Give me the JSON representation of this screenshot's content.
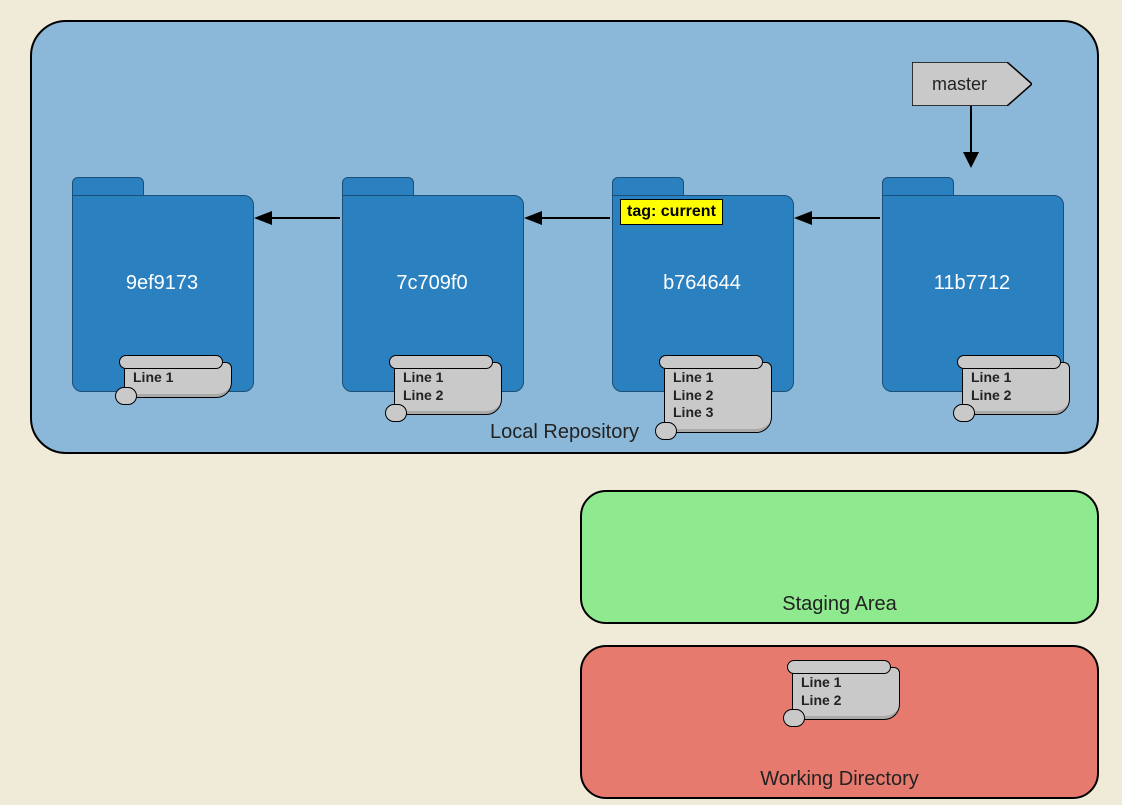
{
  "repo": {
    "label": "Local Repository",
    "master_label": "master",
    "commits": [
      {
        "hash": "9ef9173",
        "tag": null,
        "lines": [
          "Line 1"
        ]
      },
      {
        "hash": "7c709f0",
        "tag": null,
        "lines": [
          "Line 1",
          "Line 2"
        ]
      },
      {
        "hash": "b764644",
        "tag": "tag: current",
        "lines": [
          "Line 1",
          "Line 2",
          "Line 3"
        ]
      },
      {
        "hash": "11b7712",
        "tag": null,
        "lines": [
          "Line 1",
          "Line 2"
        ]
      }
    ]
  },
  "staging": {
    "label": "Staging Area"
  },
  "working": {
    "label": "Working Directory",
    "lines": [
      "Line 1",
      "Line 2"
    ]
  }
}
